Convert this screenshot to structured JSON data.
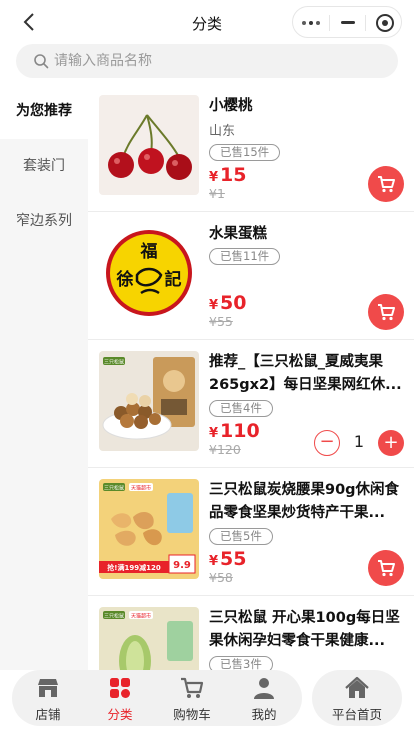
{
  "header": {
    "title": "分类"
  },
  "search": {
    "placeholder": "请输入商品名称"
  },
  "sidebar": {
    "items": [
      {
        "label": "为您推荐",
        "active": true
      },
      {
        "label": "套装门",
        "active": false
      },
      {
        "label": "窄边系列",
        "active": false
      }
    ]
  },
  "products": [
    {
      "name": "小樱桃",
      "origin": "山东",
      "sold": "已售15件",
      "currency": "¥",
      "price": "15",
      "original_price": "¥1"
    },
    {
      "name": "水果蛋糕",
      "sold": "已售11件",
      "currency": "¥",
      "price": "50",
      "original_price": "¥55"
    },
    {
      "name": "推荐_【三只松鼠_夏威夷果265gx2】每日坚果网红休...",
      "sold": "已售4件",
      "currency": "¥",
      "price": "110",
      "original_price": "¥120",
      "quantity": "1",
      "minus_label": "−",
      "plus_label": "+"
    },
    {
      "name": "三只松鼠炭烧腰果90g休闲食品零食坚果炒货特产干果...",
      "sold": "已售5件",
      "currency": "¥",
      "price": "55",
      "original_price": "¥58"
    },
    {
      "name": "三只松鼠 开心果100g每日坚果休闲孕妇零食干果健康...",
      "sold": "已售3件"
    }
  ],
  "thumb_text": {
    "logo_top": "福",
    "logo_left": "徐",
    "logo_right": "記",
    "brand_tag": "三只松鼠",
    "promo": "抢!满199减120",
    "price_tag": "9.9",
    "tmall_tag": "天猫超市"
  },
  "tabbar": {
    "items": [
      {
        "label": "店铺",
        "icon": "store-icon"
      },
      {
        "label": "分类",
        "icon": "category-icon",
        "active": true
      },
      {
        "label": "购物车",
        "icon": "cart-icon"
      },
      {
        "label": "我的",
        "icon": "user-icon"
      }
    ],
    "home": {
      "label": "平台首页",
      "icon": "home-icon"
    }
  },
  "colors": {
    "accent": "#e8232a",
    "cart_button": "#f04a4a",
    "sidebar_bg": "#f6f6f6",
    "tabbar_bg": "#f1f1f1"
  }
}
